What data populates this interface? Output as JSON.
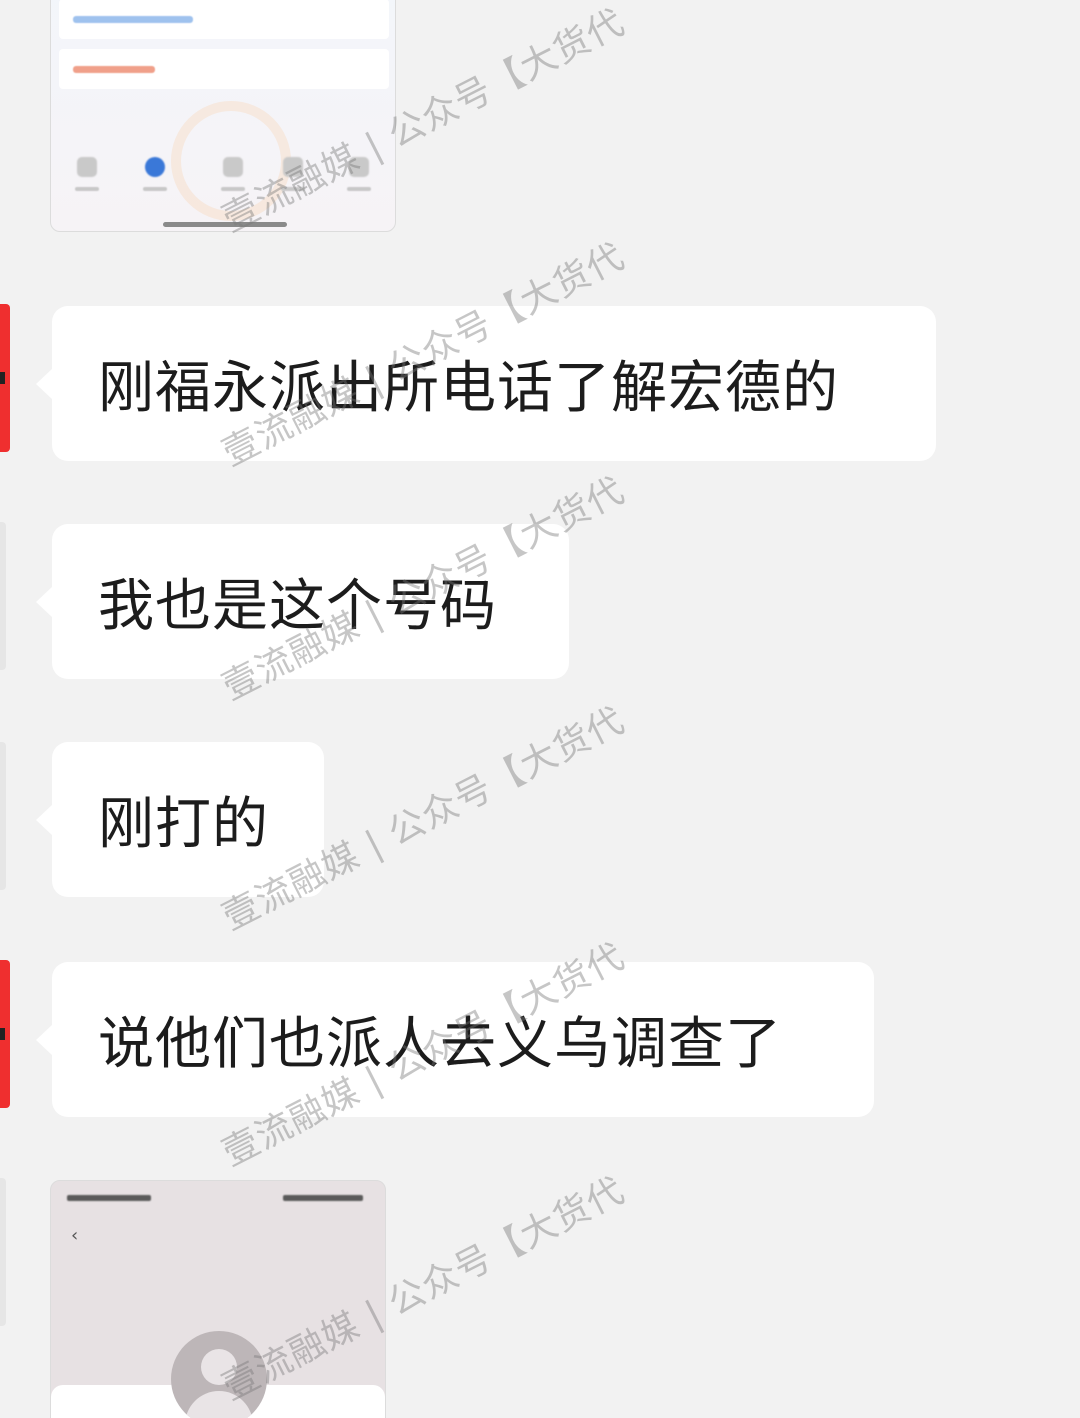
{
  "chat": {
    "messages": [
      {
        "type": "image",
        "description": "screenshot-thumbnail-app-form"
      },
      {
        "type": "text",
        "sender": "red-avatar",
        "text": "刚福永派出所电话了解宏德的"
      },
      {
        "type": "text",
        "sender": "light-avatar",
        "text": "我也是这个号码"
      },
      {
        "type": "text",
        "sender": "light-avatar",
        "text": "刚打的"
      },
      {
        "type": "text",
        "sender": "red-avatar",
        "text": "说他们也派人去义乌调查了"
      },
      {
        "type": "image",
        "description": "screenshot-thumbnail-contact"
      }
    ]
  },
  "watermark": {
    "text": "壹流融媒 | 公众号【大货代"
  },
  "colors": {
    "background": "#f2f2f2",
    "bubble": "#ffffff",
    "avatar_red": "#ef2f2f",
    "text": "#1c1c1c"
  },
  "icons": {
    "back": "‹"
  }
}
